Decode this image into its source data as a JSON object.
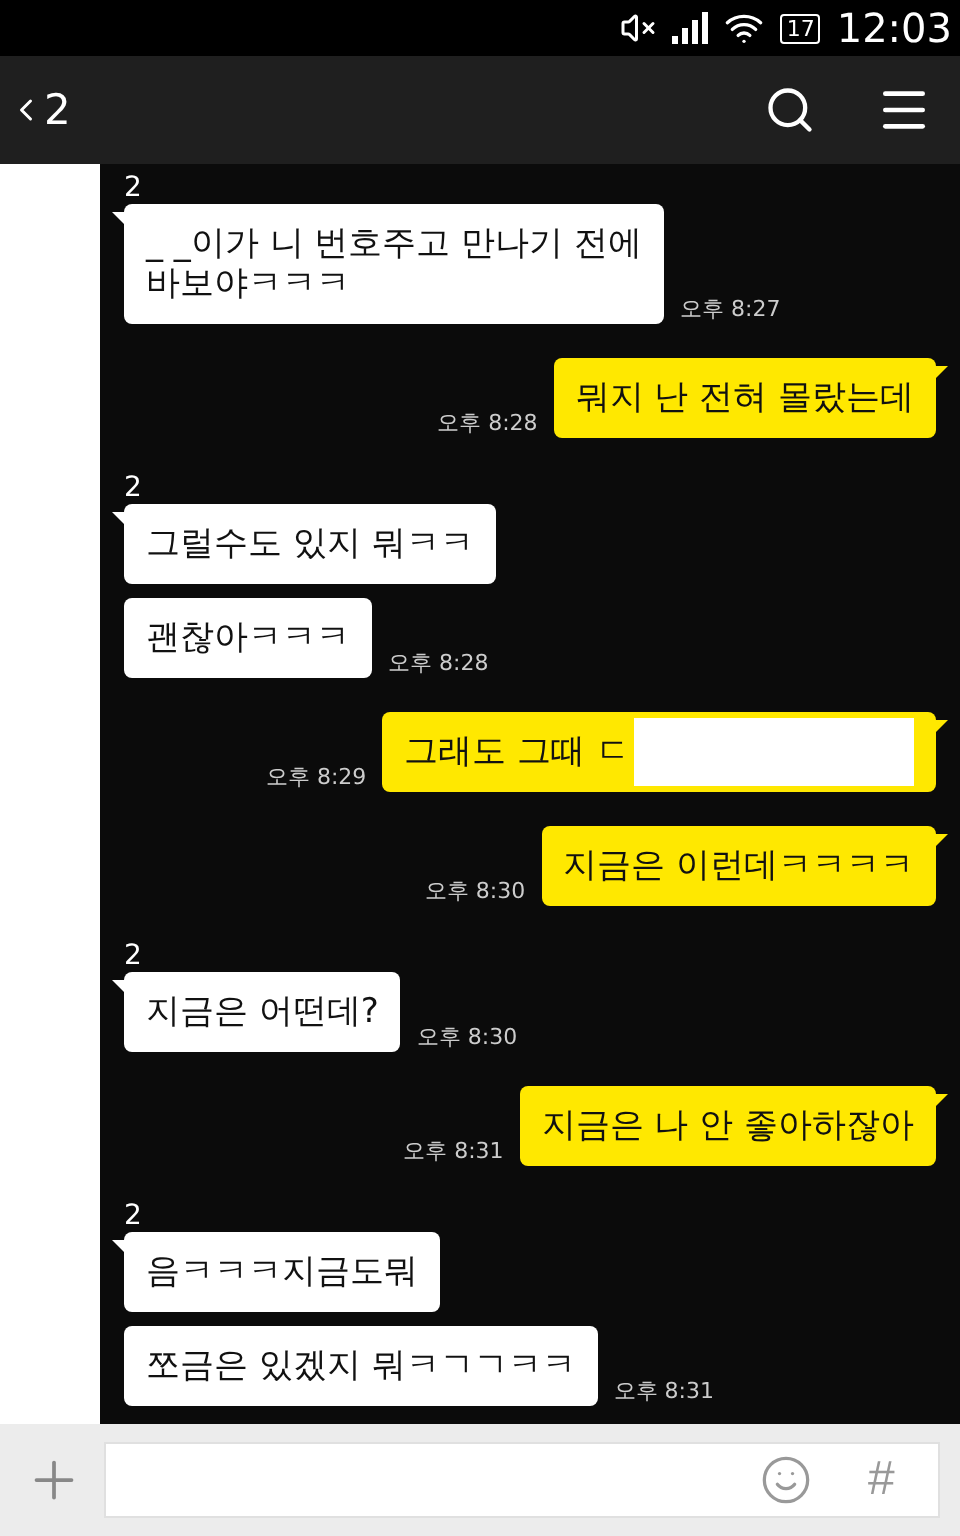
{
  "status_bar": {
    "battery": "17",
    "time": "12:03"
  },
  "header": {
    "title": "2"
  },
  "messages": [
    {
      "kind": "sender",
      "text": "2"
    },
    {
      "kind": "received",
      "text": "_ _이가 니 번호주고 만나기 전에\n바보야ㅋㅋㅋ",
      "time": "오후 8:27"
    },
    {
      "kind": "sent",
      "text": "뭐지 난 전혀 몰랐는데",
      "time": "오후 8:28",
      "redacted": false
    },
    {
      "kind": "sender",
      "text": "2"
    },
    {
      "kind": "received",
      "text": "그럴수도 있지 뭐ㅋㅋ"
    },
    {
      "kind": "received",
      "text": "괜찮아ㅋㅋㅋ",
      "time": "오후 8:28"
    },
    {
      "kind": "sent",
      "text": "그래도 그때 ㄷ",
      "time": "오후 8:29",
      "redacted": true
    },
    {
      "kind": "sent",
      "text": "지금은 이런데ㅋㅋㅋㅋ",
      "time": "오후 8:30",
      "redacted": false
    },
    {
      "kind": "sender",
      "text": "2"
    },
    {
      "kind": "received",
      "text": "지금은 어떤데?",
      "time": "오후 8:30"
    },
    {
      "kind": "sent",
      "text": "지금은 나 안 좋아하잖아",
      "time": "오후 8:31",
      "redacted": false
    },
    {
      "kind": "sender",
      "text": "2"
    },
    {
      "kind": "received",
      "text": "음ㅋㅋㅋ지금도뭐"
    },
    {
      "kind": "received",
      "text": "쪼금은 있겠지 뭐ㅋㄱㄱㅋㅋ",
      "time": "오후 8:31"
    }
  ],
  "composer": {
    "hashtag": "#"
  }
}
